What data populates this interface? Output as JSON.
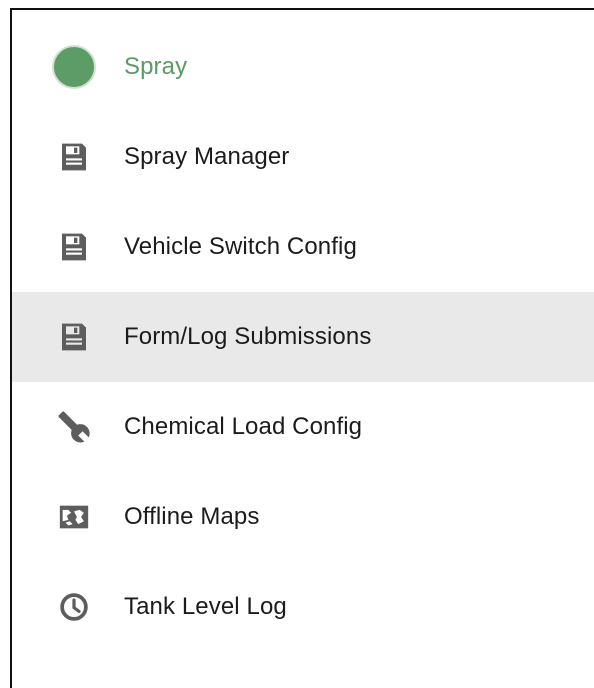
{
  "menu": {
    "items": [
      {
        "label": "Spray",
        "icon": "circle-icon",
        "active": true
      },
      {
        "label": "Spray Manager",
        "icon": "save-icon"
      },
      {
        "label": "Vehicle Switch Config",
        "icon": "save-icon"
      },
      {
        "label": "Form/Log Submissions",
        "icon": "save-icon",
        "highlighted": true
      },
      {
        "label": "Chemical Load Config",
        "icon": "wrench-icon"
      },
      {
        "label": "Offline Maps",
        "icon": "map-icon"
      },
      {
        "label": "Tank Level Log",
        "icon": "clock-icon"
      }
    ]
  },
  "colors": {
    "accent": "#5a9a64",
    "accent_circle": "#5e9c67",
    "icon": "#5d5d5d",
    "text": "#1b1b1b",
    "highlight_bg": "#e9e9e9"
  }
}
